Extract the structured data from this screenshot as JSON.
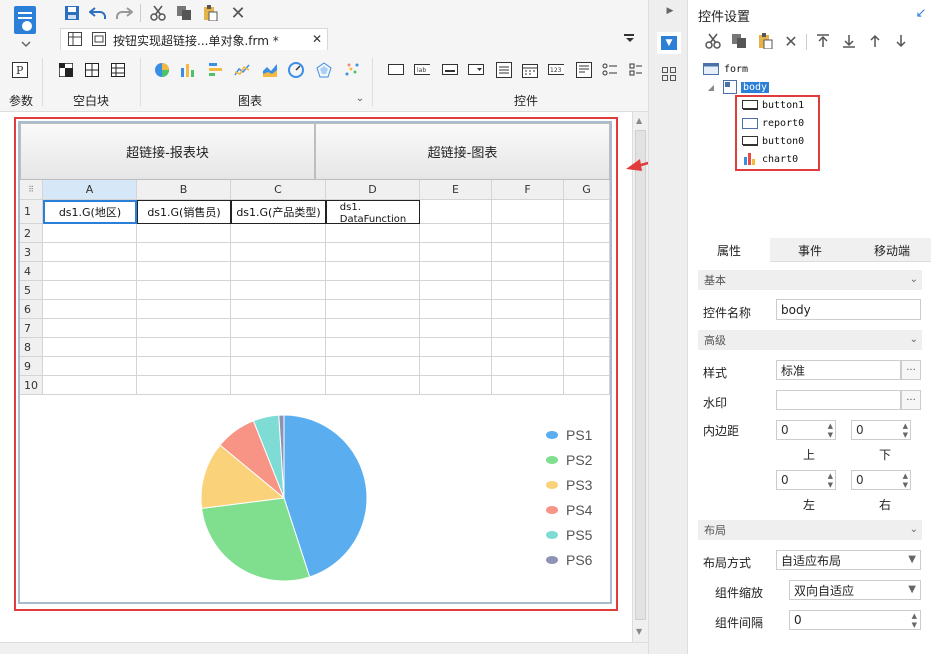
{
  "toolbar": {
    "tab_title": "按钮实现超链接...单对象.frm *",
    "groups": {
      "param": "参数",
      "blank": "空白块",
      "chart": "图表",
      "widget": "控件"
    },
    "param_icon_letter": "P"
  },
  "canvas": {
    "button1_label": "超链接-报表块",
    "button0_label": "超链接-图表",
    "columns": [
      "A",
      "B",
      "C",
      "D",
      "E",
      "F",
      "G"
    ],
    "rows": [
      "1",
      "2",
      "3",
      "4",
      "5",
      "6",
      "7",
      "8",
      "9",
      "10"
    ],
    "row1_cells": [
      "ds1.G(地区)",
      "ds1.G(销售员)",
      "ds1.G(产品类型)",
      "ds1.\nDataFunction"
    ]
  },
  "chart_data": {
    "type": "pie",
    "legend": [
      "PS1",
      "PS2",
      "PS3",
      "PS4",
      "PS5",
      "PS6"
    ],
    "values": [
      45,
      28,
      13,
      8,
      5,
      1
    ],
    "colors": [
      "#5aaef0",
      "#7fdf8e",
      "#f9d27a",
      "#f79485",
      "#7fdcd4",
      "#8e93b5"
    ],
    "legend_position": "right"
  },
  "panel": {
    "title": "控件设置",
    "tree": {
      "root": "form",
      "body": "body",
      "children": [
        "button1",
        "report0",
        "button0",
        "chart0"
      ]
    },
    "tabs": [
      "属性",
      "事件",
      "移动端"
    ],
    "section_basic": "基本",
    "widget_name_label": "控件名称",
    "widget_name_value": "body",
    "section_advanced": "高级",
    "style_label": "样式",
    "style_value": "标准",
    "watermark_label": "水印",
    "watermark_value": "",
    "padding_label": "内边距",
    "padding_top": "0",
    "padding_bottom": "0",
    "padding_left": "0",
    "padding_right": "0",
    "top_label": "上",
    "bottom_label": "下",
    "left_label": "左",
    "right_label": "右",
    "section_layout": "布局",
    "layout_mode_label": "布局方式",
    "layout_mode_value": "自适应布局",
    "scale_label": "组件缩放",
    "scale_value": "双向自适应",
    "gap_label": "组件间隔",
    "gap_value": "0"
  }
}
